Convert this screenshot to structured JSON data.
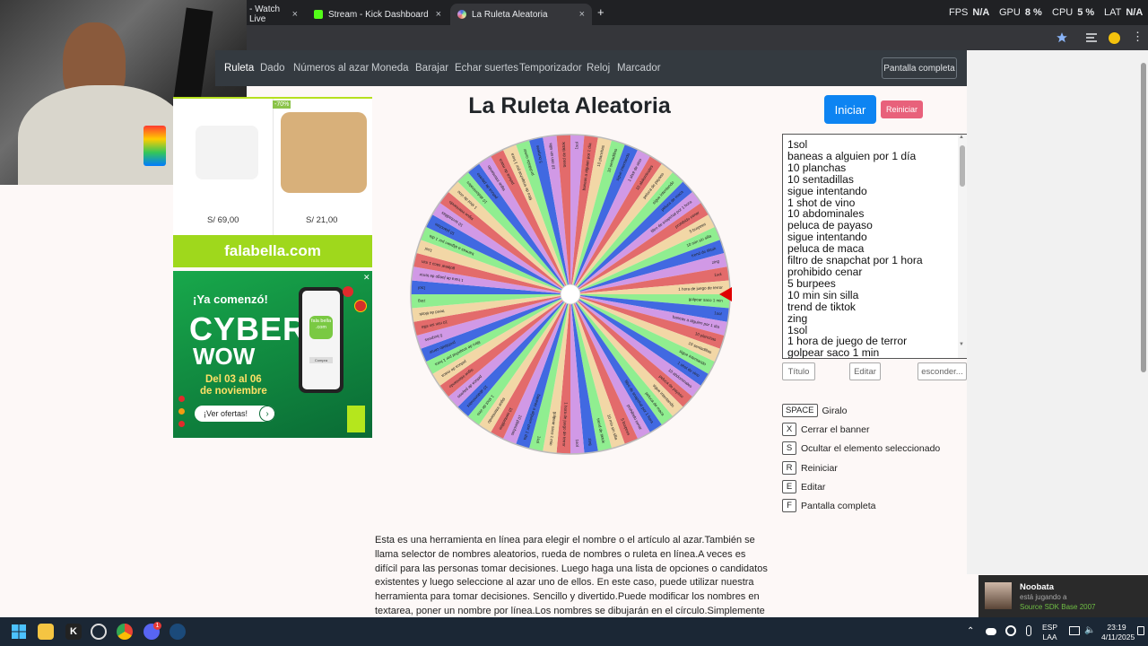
{
  "browser": {
    "tabs": [
      {
        "label": "- Watch Live",
        "close": "×"
      },
      {
        "label": "Stream - Kick Dashboard",
        "close": "×"
      },
      {
        "label": "La Ruleta Aleatoria",
        "close": "×"
      }
    ],
    "new_tab": "+",
    "stats": [
      {
        "name": "FPS",
        "value": "N/A"
      },
      {
        "name": "GPU",
        "value": "8 %"
      },
      {
        "name": "CPU",
        "value": "5 %"
      },
      {
        "name": "LAT",
        "value": "N/A"
      }
    ]
  },
  "nav": {
    "items": [
      "Ruleta",
      "Dado",
      "Números al azar",
      "Moneda",
      "Barajar",
      "Echar suertes",
      "Temporizador",
      "Reloj",
      "Marcador"
    ],
    "fullscreen": "Pantalla completa"
  },
  "ad1": {
    "discount": "-70%",
    "prices": [
      "S/ 69,00",
      "S/ 21,00"
    ],
    "brand": "falabella.com"
  },
  "ad2": {
    "line1": "¡Ya comenzó!",
    "line2": "CYBER",
    "line3": "WOW",
    "dates1": "Del 03 al 06",
    "dates2": "de noviembre",
    "cta": "¡Ver ofertas!",
    "phone_brand": "fala bella .com",
    "phone_btn": "Compra"
  },
  "page": {
    "title": "La Ruleta Aleatoria",
    "start": "Iniciar",
    "reset": "Reiniciar",
    "title_btn": "Título",
    "edit_btn": "Editar",
    "hide_btn": "esconder...",
    "description": "Esta es una herramienta en línea para elegir el nombre o el artículo al azar.También se llama selector de nombres aleatorios, rueda de nombres o ruleta en línea.A veces es difícil para las personas tomar decisiones. Luego haga una lista de opciones o candidatos existentes y luego seleccione al azar uno de ellos. En este caso, puede utilizar nuestra herramienta para tomar decisiones. Sencillo y divertido.Puede modificar los nombres en textarea, poner un nombre por línea.Los nombres se dibujarán en el círculo.Simplemente haga clic en la rueda"
  },
  "entries": [
    "1sol",
    "baneas a alguien por 1 día",
    "10 planchas",
    "10 sentadillas",
    "sigue intentando",
    "1 shot de vino",
    "10 abdominales",
    "peluca de payaso",
    "sigue intentando",
    "peluca de maca",
    "filtro de snapchat por 1 hora",
    "prohibido cenar",
    "5 burpees",
    "10 min sin silla",
    "trend de tiktok",
    "zing",
    "1sol",
    "1 hora de juego de terror",
    "golpear saco 1 min"
  ],
  "shortcuts": [
    {
      "key": "SPACE",
      "label": "Giralo"
    },
    {
      "key": "X",
      "label": "Cerrar el banner"
    },
    {
      "key": "S",
      "label": "Ocultar el elemento seleccionado"
    },
    {
      "key": "R",
      "label": "Reiniciar"
    },
    {
      "key": "E",
      "label": "Editar"
    },
    {
      "key": "F",
      "label": "Pantalla completa"
    }
  ],
  "wheel": {
    "segment_count": 72,
    "colors": [
      "#4169e1",
      "#90ee90",
      "#f2d7a6",
      "#e36b6b",
      "#d199e6"
    ]
  },
  "toast": {
    "name": "Noobata",
    "status": "está jugando a",
    "game": "Source SDK Base 2007"
  },
  "taskbar": {
    "lang1": "ESP",
    "lang2": "LAA",
    "time": "23:19",
    "date": "4/11/2025",
    "discord_badge": "1"
  },
  "colors": {
    "accent": "#0d84f2",
    "reset": "#e8617b",
    "navbar": "#343a40",
    "pointer": "#e00000"
  }
}
